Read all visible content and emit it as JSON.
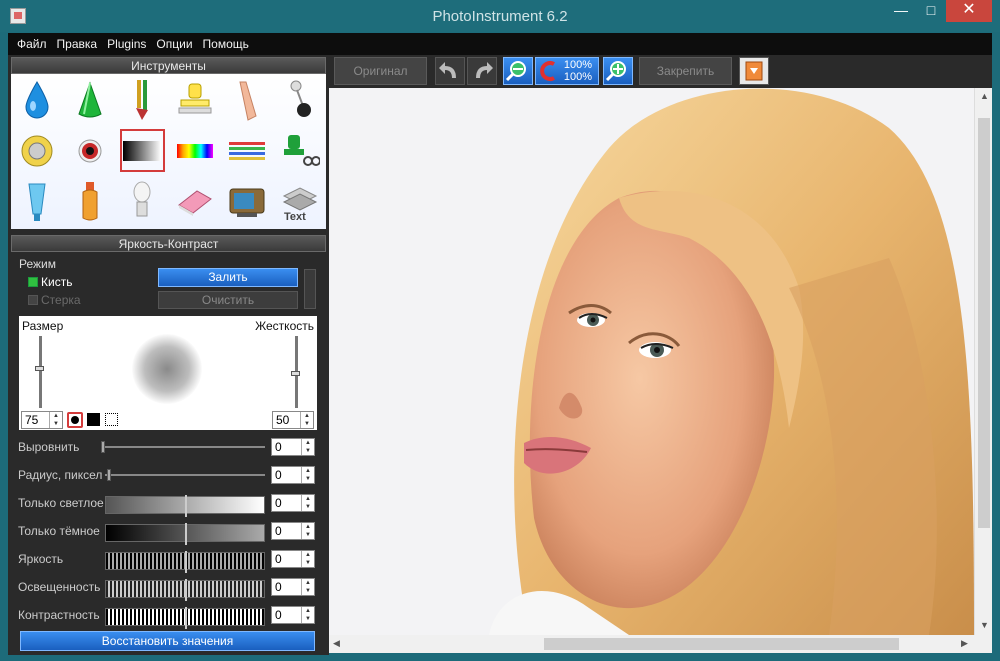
{
  "window": {
    "title": "PhotoInstrument 6.2"
  },
  "menu": [
    "Файл",
    "Правка",
    "Plugins",
    "Опции",
    "Помощь"
  ],
  "tools_panel": {
    "title": "Инструменты"
  },
  "tools": [
    {
      "icon": "water-drop-icon"
    },
    {
      "icon": "cone-icon"
    },
    {
      "icon": "brush-icon"
    },
    {
      "icon": "stamp-icon"
    },
    {
      "icon": "finger-icon"
    },
    {
      "icon": "pin-icon"
    },
    {
      "icon": "sunflower-icon"
    },
    {
      "icon": "eye-icon"
    },
    {
      "icon": "gradient-icon",
      "selected": true
    },
    {
      "icon": "rainbow-icon"
    },
    {
      "icon": "color-lines-icon"
    },
    {
      "icon": "clone-scissors-icon"
    },
    {
      "icon": "tube-icon"
    },
    {
      "icon": "bottle-icon"
    },
    {
      "icon": "lightbulb-icon"
    },
    {
      "icon": "eraser-icon"
    },
    {
      "icon": "tv-icon"
    },
    {
      "icon": "text-layers-icon"
    }
  ],
  "adjust_panel": {
    "title": "Яркость-Контраст",
    "mode_label": "Режим",
    "brush_label": "Кисть",
    "eraser_label": "Стерка",
    "fill_button": "Залить",
    "clear_button": "Очистить",
    "size_label": "Размер",
    "hardness_label": "Жесткость",
    "size_value": "75",
    "hardness_value": "50",
    "rows": [
      {
        "label": "Выровнить",
        "value": "0"
      },
      {
        "label": "Радиус, пиксел",
        "value": "0"
      },
      {
        "label": "Только светлое",
        "value": "0"
      },
      {
        "label": "Только тёмное",
        "value": "0"
      },
      {
        "label": "Яркость",
        "value": "0"
      },
      {
        "label": "Освещенность",
        "value": "0"
      },
      {
        "label": "Контрастность",
        "value": "0"
      }
    ],
    "restore_button": "Восстановить значения"
  },
  "toolbar": {
    "original_button": "Оригинал",
    "zoom_top": "100%",
    "zoom_bottom": "100%",
    "pin_button": "Закрепить"
  },
  "colors": {
    "accent": "#1a5fbf",
    "selection": "#d43b3b",
    "titlebar": "#1e6d7b"
  }
}
